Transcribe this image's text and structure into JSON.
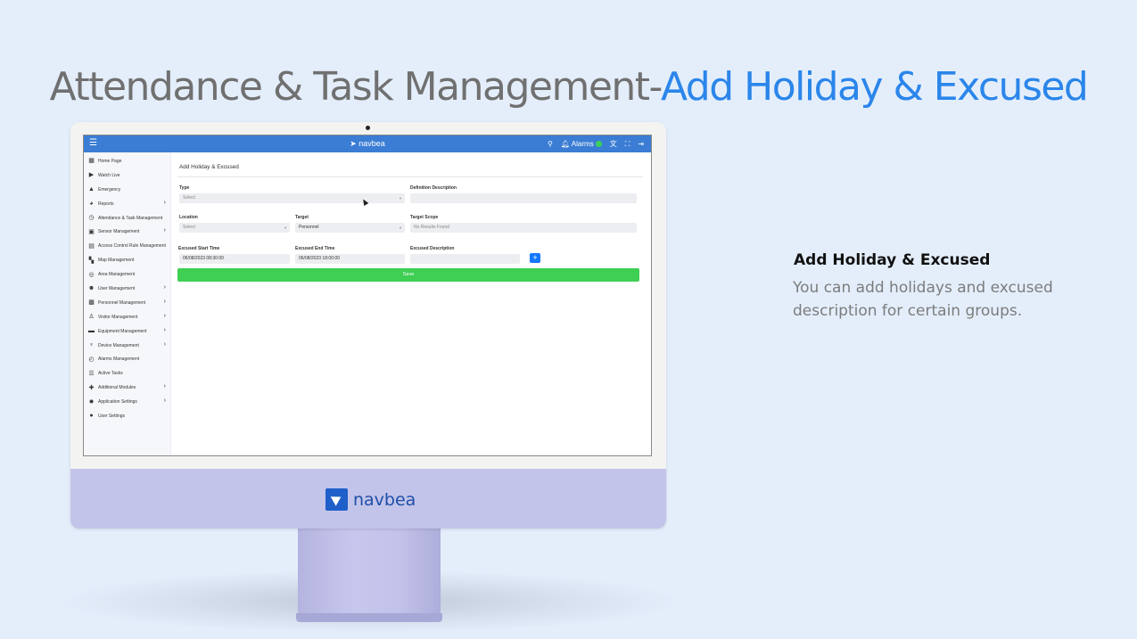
{
  "headline": {
    "gray": "Attendance & Task Management-",
    "blue": "Add Holiday & Excused"
  },
  "info_panel": {
    "title": "Add Holiday & Excused",
    "line1": "You can add holidays and excused",
    "line2": " description for certain groups."
  },
  "monitor": {
    "brand": "navbea"
  },
  "app": {
    "brand": "navbea",
    "alarms_label": "Alarms",
    "sidebar": [
      {
        "label": "Home Page",
        "icon": "grid-icon",
        "glyph": "▦",
        "chevron": false
      },
      {
        "label": "Watch Live",
        "icon": "video-icon",
        "glyph": "▶",
        "chevron": false
      },
      {
        "label": "Emergency",
        "icon": "warning-icon",
        "glyph": "▲",
        "chevron": false
      },
      {
        "label": "Reports",
        "icon": "pie-chart-icon",
        "glyph": "◕",
        "chevron": true
      },
      {
        "label": "Attendance & Task Management",
        "icon": "clock-icon",
        "glyph": "◷",
        "chevron": false
      },
      {
        "label": "Sensor Management",
        "icon": "sensor-icon",
        "glyph": "▣",
        "chevron": true
      },
      {
        "label": "Access Control Rule Management",
        "icon": "badge-icon",
        "glyph": "▤",
        "chevron": false
      },
      {
        "label": "Map Management",
        "icon": "map-icon",
        "glyph": "▚",
        "chevron": false
      },
      {
        "label": "Area Management",
        "icon": "area-icon",
        "glyph": "◎",
        "chevron": false
      },
      {
        "label": "User Management",
        "icon": "users-icon",
        "glyph": "☻",
        "chevron": true
      },
      {
        "label": "Personnel Management",
        "icon": "person-card-icon",
        "glyph": "▩",
        "chevron": true
      },
      {
        "label": "Visitor Management",
        "icon": "visitor-icon",
        "glyph": "♙",
        "chevron": true
      },
      {
        "label": "Equipment Management",
        "icon": "truck-icon",
        "glyph": "▬",
        "chevron": true
      },
      {
        "label": "Device Management",
        "icon": "antenna-icon",
        "glyph": "♆",
        "chevron": true
      },
      {
        "label": "Alarms Management",
        "icon": "alarm-clock-icon",
        "glyph": "◴",
        "chevron": false
      },
      {
        "label": "Active Tasks",
        "icon": "list-icon",
        "glyph": "☰",
        "chevron": false
      },
      {
        "label": "Additional Modules",
        "icon": "puzzle-icon",
        "glyph": "✚",
        "chevron": true
      },
      {
        "label": "Application Settings",
        "icon": "gear-icon",
        "glyph": "✹",
        "chevron": true
      },
      {
        "label": "User Settings",
        "icon": "user-circle-icon",
        "glyph": "●",
        "chevron": false
      }
    ],
    "form": {
      "title": "Add Holiday & Excused",
      "type_label": "Type",
      "type_value": "Select",
      "definition_label": "Definition Description",
      "definition_value": "",
      "location_label": "Location",
      "location_value": "Select",
      "target_label": "Target",
      "target_value": "Personnel",
      "target_scope_label": "Target Scope",
      "target_scope_value": "No Results Found",
      "start_label": "Excused Start Time",
      "start_value": "06/08/2023 08:30:00",
      "end_label": "Excused End Time",
      "end_value": "06/08/2023 18:00:00",
      "excused_desc_label": "Excused Description",
      "excused_desc_value": "",
      "add_button": "+",
      "save_button": "Save"
    }
  }
}
